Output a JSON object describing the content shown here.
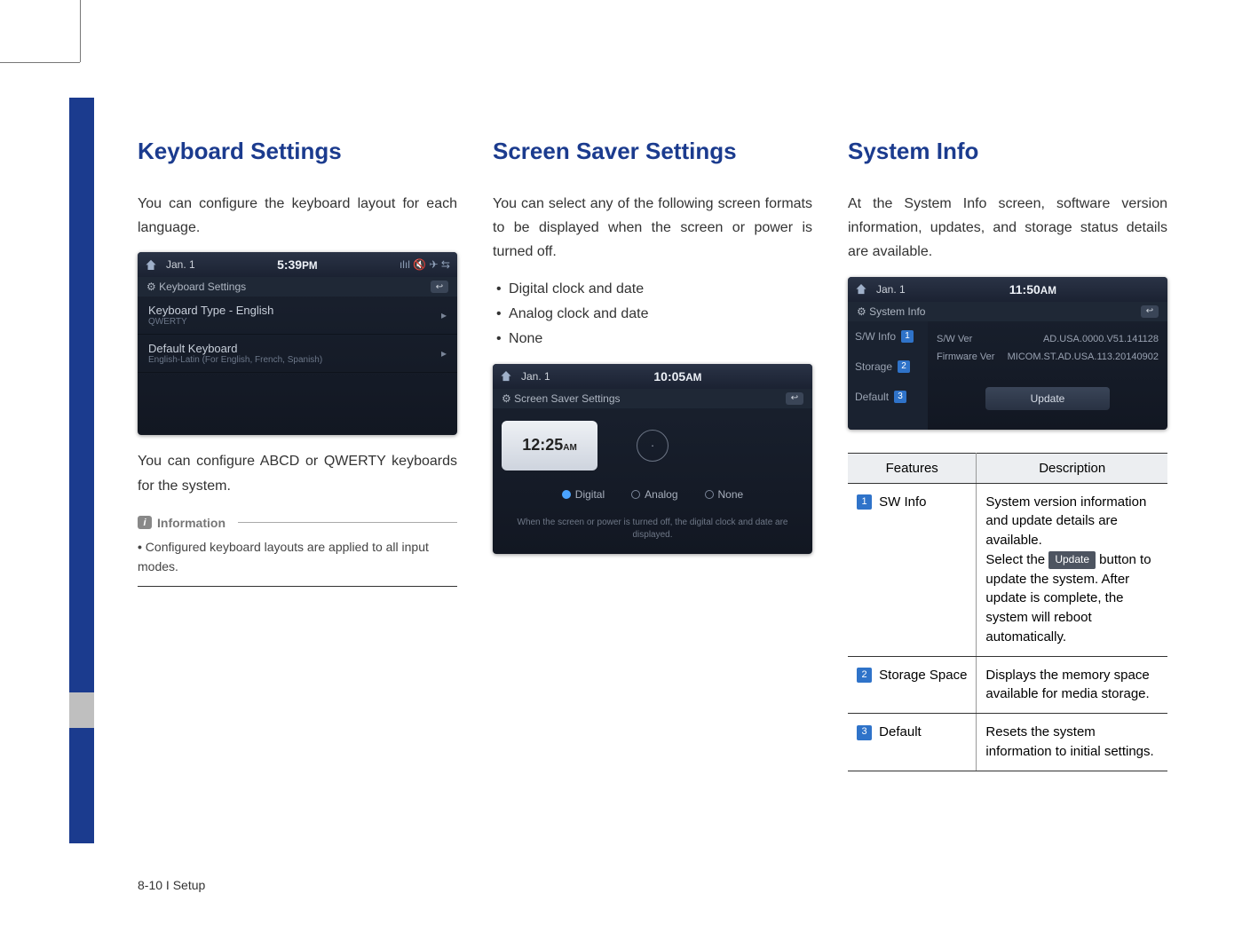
{
  "col1": {
    "heading": "Keyboard Settings",
    "para1": "You can configure the keyboard layout for each language.",
    "para2": "You can configure ABCD or QWERTY keyboards for the system.",
    "shot": {
      "date": "Jan.  1",
      "time": "5:39",
      "time_suffix": "PM",
      "subtitle": "Keyboard Settings",
      "row1_label": "Keyboard Type - English",
      "row1_sub": "QWERTY",
      "row2_label": "Default Keyboard",
      "row2_sub": "English-Latin (For English, French, Spanish)"
    },
    "info_title": "Information",
    "info_bullet": "Configured keyboard layouts are applied to all input modes."
  },
  "col2": {
    "heading": "Screen Saver Settings",
    "para1": "You can select any of the following screen formats to be displayed when the screen or power is turned off.",
    "opts": [
      "Digital clock and date",
      "Analog clock and date",
      "None"
    ],
    "shot": {
      "date": "Jan.  1",
      "time": "10:05",
      "time_suffix": "AM",
      "subtitle": "Screen Saver Settings",
      "digital_time": "12:25",
      "digital_suffix": "AM",
      "opt_digital": "Digital",
      "opt_analog": "Analog",
      "opt_none": "None",
      "note": "When the screen or power is turned off, the digital clock and date are displayed."
    }
  },
  "col3": {
    "heading": "System Info",
    "para1": "At the System Info screen, software version information, updates, and storage status details are available.",
    "shot": {
      "date": "Jan.  1",
      "time": "11:50",
      "time_suffix": "AM",
      "subtitle": "System Info",
      "tabs": [
        "S/W Info",
        "Storage",
        "Default"
      ],
      "kv1_k": "S/W Ver",
      "kv1_v": "AD.USA.0000.V51.141128",
      "kv2_k": "Firmware Ver",
      "kv2_v": "MICOM.ST.AD.USA.113.20140902",
      "update_btn": "Update"
    },
    "table": {
      "h1": "Features",
      "h2": "Description",
      "r1_label": "SW Info",
      "r1_desc_a": "System version information and update details are available.",
      "r1_desc_b1": "Select the ",
      "r1_chip": "Update",
      "r1_desc_b2": " button to update the system. After update is complete, the system will reboot automatically.",
      "r2_label": "Storage Space",
      "r2_desc": "Displays the memory space available for media storage.",
      "r3_label": "Default",
      "r3_desc": "Resets the system information to initial settings."
    }
  },
  "footer": "8-10 I Setup"
}
